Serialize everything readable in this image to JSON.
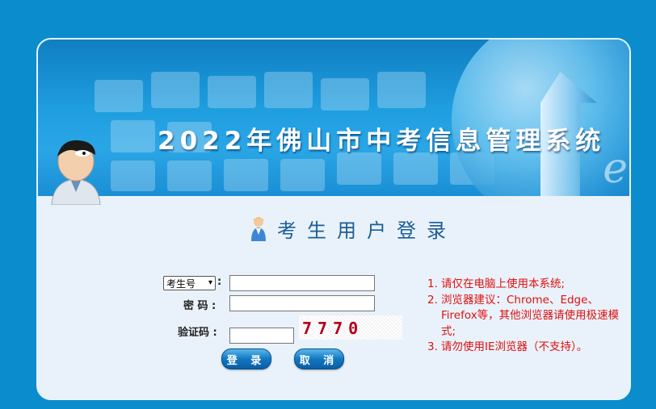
{
  "banner": {
    "title": "2022年佛山市中考信息管理系统"
  },
  "login": {
    "title": "考生用户登录"
  },
  "form": {
    "id_type_selected": "考生号",
    "id_colon": ":",
    "password_label": "密 码 :",
    "captcha_label": "验证码 :",
    "captcha_text": "7770",
    "login_button": "登 录",
    "cancel_button": "取 消"
  },
  "notes": [
    {
      "num": "1.",
      "text": "请仅在电脑上使用本系统;"
    },
    {
      "num": "2.",
      "text": "浏览器建议：Chrome、Edge、Firefox等，其他浏览器请使用极速模式;"
    },
    {
      "num": "3.",
      "text": "请勿使用IE浏览器（不支持）。"
    }
  ],
  "colors": {
    "background": "#0b8ccc",
    "notes_text": "#e01010",
    "button": "#1277c1",
    "login_title": "#1b5d97"
  },
  "icons": [
    "user-avatar-icon",
    "student-icon",
    "chevron-down-icon",
    "globe-arrow-logo"
  ]
}
